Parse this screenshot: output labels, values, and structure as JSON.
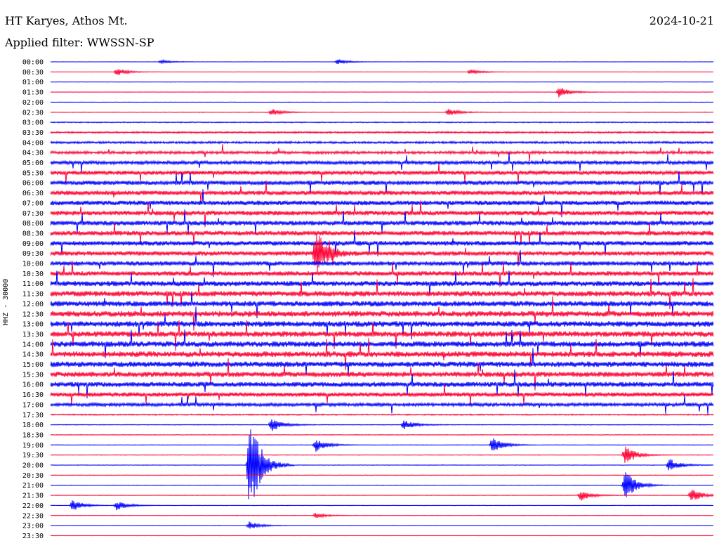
{
  "header": {
    "station": "HT Karyes, Athos Mt.",
    "date": "2024-10-21",
    "filter": "Applied filter: WWSSN-SP",
    "channel_label": "HHZ - 30000"
  },
  "chart_data": {
    "type": "helicorder",
    "row_labels": [
      "00:00",
      "00:30",
      "01:00",
      "01:30",
      "02:00",
      "02:30",
      "03:00",
      "03:30",
      "04:00",
      "04:30",
      "05:00",
      "05:30",
      "06:00",
      "06:30",
      "07:00",
      "07:30",
      "08:00",
      "08:30",
      "09:00",
      "09:30",
      "10:00",
      "10:30",
      "11:00",
      "11:30",
      "12:00",
      "12:30",
      "13:00",
      "13:30",
      "14:00",
      "14:30",
      "15:00",
      "15:30",
      "16:00",
      "16:30",
      "17:00",
      "17:30",
      "18:00",
      "18:30",
      "19:00",
      "19:30",
      "20:00",
      "20:30",
      "21:00",
      "21:30",
      "22:00",
      "22:30",
      "23:00",
      "23:30"
    ],
    "colors": [
      "#0000ff",
      "#ff0033"
    ],
    "noise_level": [
      0.15,
      0.15,
      0.15,
      0.2,
      0.2,
      0.3,
      0.5,
      0.8,
      1.0,
      1.3,
      1.6,
      1.9,
      2.0,
      2.1,
      2.2,
      2.2,
      2.2,
      2.2,
      2.2,
      2.1,
      2.1,
      2.2,
      2.4,
      2.6,
      2.6,
      2.7,
      2.7,
      2.7,
      2.7,
      2.7,
      2.6,
      2.5,
      2.4,
      2.0,
      1.6,
      0.6,
      0.35,
      0.3,
      0.25,
      0.25,
      0.25,
      0.25,
      0.25,
      0.25,
      0.25,
      0.25,
      0.2,
      0.2
    ],
    "events": [
      {
        "row": 0,
        "minute": 5,
        "amp": 3
      },
      {
        "row": 0,
        "minute": 13,
        "amp": 4
      },
      {
        "row": 1,
        "minute": 3,
        "amp": 6
      },
      {
        "row": 1,
        "minute": 19,
        "amp": 4
      },
      {
        "row": 3,
        "minute": 23,
        "amp": 8
      },
      {
        "row": 5,
        "minute": 10,
        "amp": 5
      },
      {
        "row": 5,
        "minute": 18,
        "amp": 5
      },
      {
        "row": 19,
        "minute": 12,
        "amp": 35
      },
      {
        "row": 36,
        "minute": 10,
        "amp": 10
      },
      {
        "row": 36,
        "minute": 16,
        "amp": 7
      },
      {
        "row": 38,
        "minute": 12,
        "amp": 10
      },
      {
        "row": 38,
        "minute": 20,
        "amp": 12
      },
      {
        "row": 39,
        "minute": 26,
        "amp": 14
      },
      {
        "row": 40,
        "minute": 9,
        "amp": 80
      },
      {
        "row": 40,
        "minute": 28,
        "amp": 10
      },
      {
        "row": 42,
        "minute": 26,
        "amp": 22
      },
      {
        "row": 43,
        "minute": 24,
        "amp": 8
      },
      {
        "row": 43,
        "minute": 29,
        "amp": 10
      },
      {
        "row": 44,
        "minute": 1,
        "amp": 8
      },
      {
        "row": 44,
        "minute": 3,
        "amp": 7
      },
      {
        "row": 45,
        "minute": 12,
        "amp": 4
      },
      {
        "row": 46,
        "minute": 9,
        "amp": 6
      }
    ]
  }
}
